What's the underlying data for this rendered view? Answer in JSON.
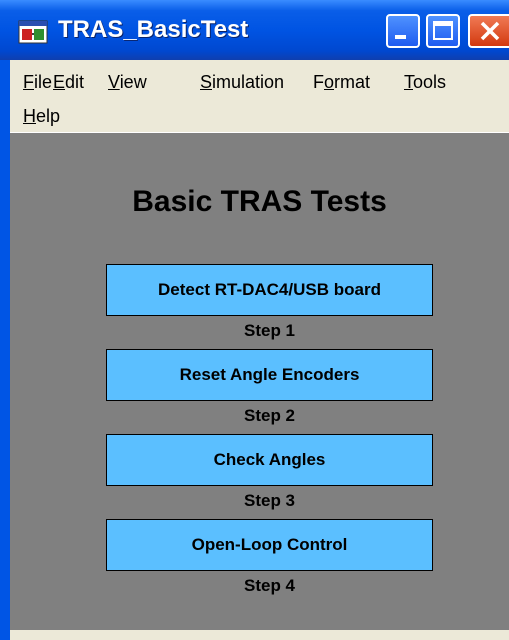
{
  "window": {
    "title": "TRAS_BasicTest",
    "icon": "simulink-model-icon"
  },
  "title_buttons": {
    "minimize_icon": "minimize-icon",
    "maximize_icon": "maximize-icon",
    "close_icon": "close-icon"
  },
  "menu": {
    "file": {
      "mnemonic": "F",
      "rest": "ile"
    },
    "edit": {
      "mnemonic": "E",
      "rest": "dit"
    },
    "view": {
      "mnemonic": "V",
      "rest": "iew"
    },
    "simulation": {
      "mnemonic": "S",
      "rest": "imulation"
    },
    "format": {
      "pre": "F",
      "mnemonic": "o",
      "rest": "rmat"
    },
    "tools": {
      "mnemonic": "T",
      "rest": "ools"
    },
    "help": {
      "mnemonic": "H",
      "rest": "elp"
    }
  },
  "main": {
    "heading": "Basic TRAS Tests",
    "steps": [
      {
        "button": "Detect RT-DAC4/USB board",
        "label": "Step 1"
      },
      {
        "button": "Reset Angle Encoders",
        "label": "Step 2"
      },
      {
        "button": "Check Angles",
        "label": "Step 3"
      },
      {
        "button": "Open-Loop Control",
        "label": "Step 4"
      }
    ]
  },
  "colors": {
    "titlebar": "#0054e3",
    "canvas": "#808080",
    "button": "#5bbfff",
    "menubar": "#ece9d8"
  }
}
